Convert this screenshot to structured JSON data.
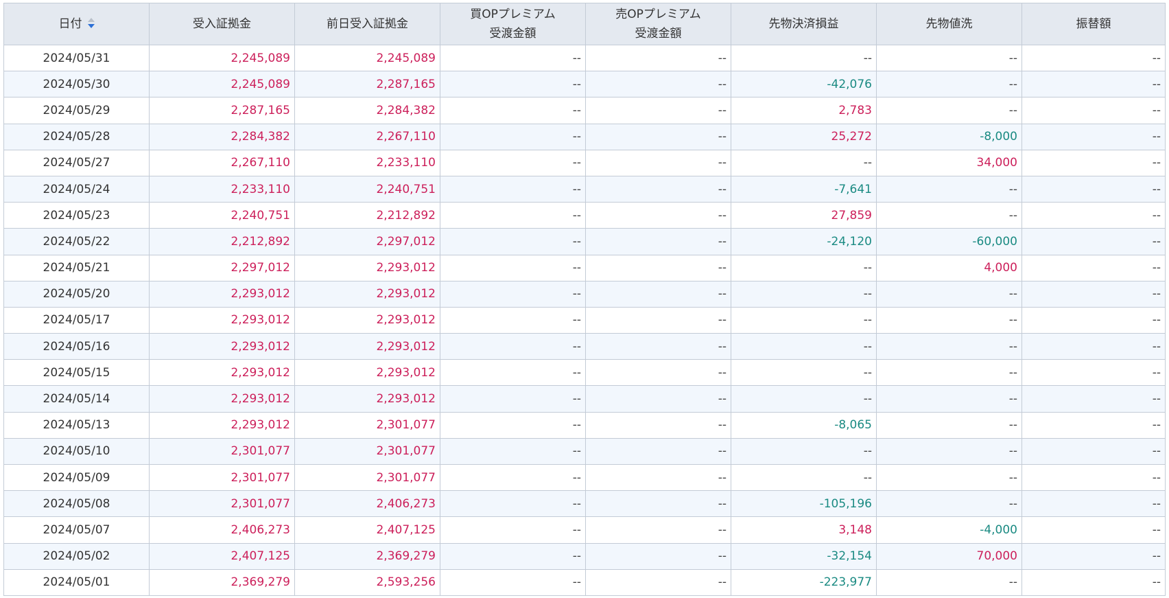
{
  "header": {
    "col_date": "日付",
    "col_margin": "受入証拠金",
    "col_prev_margin": "前日受入証拠金",
    "col_buy_op_l1": "買OPプレミアム",
    "col_buy_op_l2": "受渡金額",
    "col_sell_op_l1": "売OPプレミアム",
    "col_sell_op_l2": "受渡金額",
    "col_futures_pl": "先物決済損益",
    "col_futures_mtm": "先物値洗",
    "col_transfer": "振替額"
  },
  "colors": {
    "positive": "#cc1f5a",
    "negative": "#1a8a82",
    "header_bg": "#e4e9f0",
    "row_alt_bg": "#f2f7fd",
    "sort_active": "#2c6fd6"
  },
  "sort": {
    "column": "date",
    "direction": "desc",
    "icon": "sort-desc-icon"
  },
  "rows": [
    {
      "date": "2024/05/31",
      "margin": "2,245,089",
      "prev_margin": "2,245,089",
      "buy_op": "--",
      "sell_op": "--",
      "futures_pl": "--",
      "futures_mtm": "--",
      "transfer": "--"
    },
    {
      "date": "2024/05/30",
      "margin": "2,245,089",
      "prev_margin": "2,287,165",
      "buy_op": "--",
      "sell_op": "--",
      "futures_pl": "-42,076",
      "futures_mtm": "--",
      "transfer": "--"
    },
    {
      "date": "2024/05/29",
      "margin": "2,287,165",
      "prev_margin": "2,284,382",
      "buy_op": "--",
      "sell_op": "--",
      "futures_pl": "2,783",
      "futures_mtm": "--",
      "transfer": "--"
    },
    {
      "date": "2024/05/28",
      "margin": "2,284,382",
      "prev_margin": "2,267,110",
      "buy_op": "--",
      "sell_op": "--",
      "futures_pl": "25,272",
      "futures_mtm": "-8,000",
      "transfer": "--"
    },
    {
      "date": "2024/05/27",
      "margin": "2,267,110",
      "prev_margin": "2,233,110",
      "buy_op": "--",
      "sell_op": "--",
      "futures_pl": "--",
      "futures_mtm": "34,000",
      "transfer": "--"
    },
    {
      "date": "2024/05/24",
      "margin": "2,233,110",
      "prev_margin": "2,240,751",
      "buy_op": "--",
      "sell_op": "--",
      "futures_pl": "-7,641",
      "futures_mtm": "--",
      "transfer": "--"
    },
    {
      "date": "2024/05/23",
      "margin": "2,240,751",
      "prev_margin": "2,212,892",
      "buy_op": "--",
      "sell_op": "--",
      "futures_pl": "27,859",
      "futures_mtm": "--",
      "transfer": "--"
    },
    {
      "date": "2024/05/22",
      "margin": "2,212,892",
      "prev_margin": "2,297,012",
      "buy_op": "--",
      "sell_op": "--",
      "futures_pl": "-24,120",
      "futures_mtm": "-60,000",
      "transfer": "--"
    },
    {
      "date": "2024/05/21",
      "margin": "2,297,012",
      "prev_margin": "2,293,012",
      "buy_op": "--",
      "sell_op": "--",
      "futures_pl": "--",
      "futures_mtm": "4,000",
      "transfer": "--"
    },
    {
      "date": "2024/05/20",
      "margin": "2,293,012",
      "prev_margin": "2,293,012",
      "buy_op": "--",
      "sell_op": "--",
      "futures_pl": "--",
      "futures_mtm": "--",
      "transfer": "--"
    },
    {
      "date": "2024/05/17",
      "margin": "2,293,012",
      "prev_margin": "2,293,012",
      "buy_op": "--",
      "sell_op": "--",
      "futures_pl": "--",
      "futures_mtm": "--",
      "transfer": "--"
    },
    {
      "date": "2024/05/16",
      "margin": "2,293,012",
      "prev_margin": "2,293,012",
      "buy_op": "--",
      "sell_op": "--",
      "futures_pl": "--",
      "futures_mtm": "--",
      "transfer": "--"
    },
    {
      "date": "2024/05/15",
      "margin": "2,293,012",
      "prev_margin": "2,293,012",
      "buy_op": "--",
      "sell_op": "--",
      "futures_pl": "--",
      "futures_mtm": "--",
      "transfer": "--"
    },
    {
      "date": "2024/05/14",
      "margin": "2,293,012",
      "prev_margin": "2,293,012",
      "buy_op": "--",
      "sell_op": "--",
      "futures_pl": "--",
      "futures_mtm": "--",
      "transfer": "--"
    },
    {
      "date": "2024/05/13",
      "margin": "2,293,012",
      "prev_margin": "2,301,077",
      "buy_op": "--",
      "sell_op": "--",
      "futures_pl": "-8,065",
      "futures_mtm": "--",
      "transfer": "--"
    },
    {
      "date": "2024/05/10",
      "margin": "2,301,077",
      "prev_margin": "2,301,077",
      "buy_op": "--",
      "sell_op": "--",
      "futures_pl": "--",
      "futures_mtm": "--",
      "transfer": "--"
    },
    {
      "date": "2024/05/09",
      "margin": "2,301,077",
      "prev_margin": "2,301,077",
      "buy_op": "--",
      "sell_op": "--",
      "futures_pl": "--",
      "futures_mtm": "--",
      "transfer": "--"
    },
    {
      "date": "2024/05/08",
      "margin": "2,301,077",
      "prev_margin": "2,406,273",
      "buy_op": "--",
      "sell_op": "--",
      "futures_pl": "-105,196",
      "futures_mtm": "--",
      "transfer": "--"
    },
    {
      "date": "2024/05/07",
      "margin": "2,406,273",
      "prev_margin": "2,407,125",
      "buy_op": "--",
      "sell_op": "--",
      "futures_pl": "3,148",
      "futures_mtm": "-4,000",
      "transfer": "--"
    },
    {
      "date": "2024/05/02",
      "margin": "2,407,125",
      "prev_margin": "2,369,279",
      "buy_op": "--",
      "sell_op": "--",
      "futures_pl": "-32,154",
      "futures_mtm": "70,000",
      "transfer": "--"
    },
    {
      "date": "2024/05/01",
      "margin": "2,369,279",
      "prev_margin": "2,593,256",
      "buy_op": "--",
      "sell_op": "--",
      "futures_pl": "-223,977",
      "futures_mtm": "--",
      "transfer": "--"
    }
  ]
}
